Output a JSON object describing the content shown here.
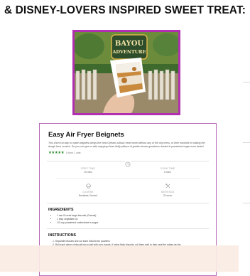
{
  "header": {
    "headline": "& DISNEY-LOVERS INSPIRED SWEET TREAT:"
  },
  "hero": {
    "sign_text": [
      "BAYOU",
      "ADVENTURE"
    ]
  },
  "recipe": {
    "title": "Easy Air Fryer Beignets",
    "description": "This short cut way to make beignets brings the New Orleans classic treat home without any of the oily mess, or time involved in making the dough from scratch. So you can get on with enjoying these fluffy pillows of golden brown goodness dusted in powdered sugar even faster!",
    "stars": "★★★★★",
    "rating_text": "5 from 1 vote",
    "meta": [
      {
        "label": "PREP TIME",
        "value": "15 mins",
        "icon": "clock-icon"
      },
      {
        "label": "COOK TIME",
        "value": "8 mins",
        "icon": "clock-icon"
      },
      {
        "label": "COURSE",
        "value": "Breakfast, Dessert",
        "icon": "chef-hat-icon"
      },
      {
        "label": "SERVINGS",
        "value": "32 serve",
        "icon": "utensils-icon"
      }
    ],
    "ingredients_heading": "INGREDIENTS",
    "ingredients": [
      "1 can 8 count large biscuits (Grands)",
      "1 tbsp vegetable oil",
      "1/2 cup powdered confectioner's sugar"
    ],
    "instructions_heading": "INSTRUCTIONS",
    "instructions": [
      "1. Separate biscuits and cut each biscuit into quarters.",
      "2. Roll each piece of biscuit into a ball with your hands. If using flaky biscuits, roll them well to help seal the edges as the"
    ]
  },
  "colors": {
    "accent": "#b12fb0",
    "stars": "#2f8f2f"
  }
}
